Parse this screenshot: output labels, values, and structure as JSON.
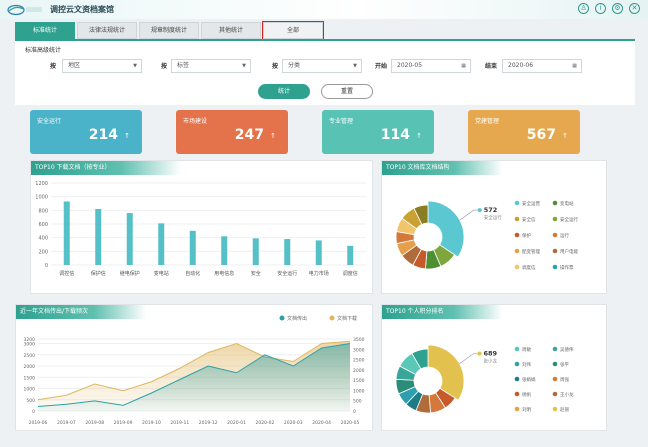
{
  "app": {
    "title": "调控云文资档案馆"
  },
  "top_icons": [
    "user-icon",
    "info-icon",
    "settings-icon",
    "close-icon"
  ],
  "tabs": [
    {
      "label": "标准统计",
      "active": true
    },
    {
      "label": "法律法规统计",
      "active": false
    },
    {
      "label": "规章制度统计",
      "active": false
    },
    {
      "label": "其他统计",
      "active": false
    },
    {
      "label": "全部",
      "active": false,
      "highlighted": true
    }
  ],
  "filters": {
    "title": "标准高级统计",
    "by_area_label": "按",
    "area_value": "地区",
    "by_tag_label": "按",
    "tag_value": "标签",
    "by_category_label": "按",
    "category_value": "分类",
    "start_label": "开始",
    "start_value": "2020-05",
    "end_label": "结束",
    "end_value": "2020-06",
    "stat_button": "统计",
    "reset_button": "重置"
  },
  "cards": [
    {
      "label": "安全运行",
      "value": "214",
      "color": "#4bb3c9"
    },
    {
      "label": "市场建设",
      "value": "247",
      "color": "#e4724b"
    },
    {
      "label": "专业管理",
      "value": "114",
      "color": "#58c2b5"
    },
    {
      "label": "党建管理",
      "value": "567",
      "color": "#e6a84e"
    }
  ],
  "panels": {
    "download_title": "TOP10 下载文档（按专业）",
    "structure_title": "TOP10 文档库文档结构",
    "trend_title": "近一年文档传出/下载频次",
    "ranking_title": "TOP10 个人积分排名"
  },
  "chart_data": [
    {
      "type": "bar",
      "title": "TOP10 下载文档（按专业）",
      "categories": [
        "调控信",
        "保护信",
        "继电保护",
        "变电站",
        "自动化",
        "用电信息",
        "安全",
        "安全运行",
        "电力市场",
        "调度信"
      ],
      "values": [
        930,
        820,
        760,
        610,
        500,
        420,
        390,
        380,
        360,
        280
      ],
      "yticks": [
        0,
        200,
        400,
        600,
        800,
        1000,
        1200
      ],
      "ylim": [
        0,
        1200
      ]
    },
    {
      "type": "pie",
      "title": "TOP10 文档库文档结构",
      "callout_value": "572",
      "callout_label": "安全运行",
      "slices": [
        {
          "value": 572,
          "color": "#5bc7d0"
        },
        {
          "value": 150,
          "color": "#7fa53d"
        },
        {
          "value": 130,
          "color": "#4f8f33"
        },
        {
          "value": 110,
          "color": "#c65a2a"
        },
        {
          "value": 120,
          "color": "#b06b3b"
        },
        {
          "value": 110,
          "color": "#e6a04a"
        },
        {
          "value": 100,
          "color": "#d4783c"
        },
        {
          "value": 120,
          "color": "#f2c46c"
        },
        {
          "value": 130,
          "color": "#c9a233"
        },
        {
          "value": 120,
          "color": "#8a7d24"
        }
      ],
      "legend": [
        {
          "label": "安全运营",
          "color": "#5bc7d0"
        },
        {
          "label": "变电站",
          "color": "#4f8f33"
        },
        {
          "label": "安全信",
          "color": "#c9a233"
        },
        {
          "label": "安全运行",
          "color": "#7fa53d"
        },
        {
          "label": "保护",
          "color": "#c65a2a"
        },
        {
          "label": "运行",
          "color": "#d4783c"
        },
        {
          "label": "配变管理",
          "color": "#e6a04a"
        },
        {
          "label": "用户电能",
          "color": "#b06b3b"
        },
        {
          "label": "调度信",
          "color": "#f2c46c"
        },
        {
          "label": "操作票",
          "color": "#2e9fb0"
        }
      ]
    },
    {
      "type": "area",
      "title": "近一年文档传出/下载频次",
      "x": [
        "2019-06",
        "2019-07",
        "2019-08",
        "2019-09",
        "2019-10",
        "2019-11",
        "2019-12",
        "2020-01",
        "2020-02",
        "2020-03",
        "2020-04",
        "2020-05"
      ],
      "series": [
        {
          "name": "文档传出",
          "color": "#2e9fa8",
          "values": [
            200,
            300,
            450,
            250,
            800,
            1400,
            2000,
            1700,
            2500,
            2000,
            2800,
            3000
          ]
        },
        {
          "name": "文档下载",
          "color": "#e0b660",
          "values": [
            500,
            700,
            1200,
            900,
            1300,
            1900,
            2600,
            3000,
            2400,
            2200,
            3000,
            3100
          ]
        }
      ],
      "yticks_left": [
        0,
        500,
        1000,
        1500,
        2000,
        2500,
        3000,
        3200
      ],
      "yticks_right": [
        0,
        500,
        1000,
        1500,
        2000,
        2500,
        3000,
        3500
      ],
      "ylim": [
        0,
        3200
      ]
    },
    {
      "type": "pie",
      "title": "TOP10 个人积分排名",
      "callout_value": "689",
      "callout_label": "张小龙",
      "slices": [
        {
          "value": 689,
          "color": "#e2c14f"
        },
        {
          "value": 140,
          "color": "#c65a2a"
        },
        {
          "value": 160,
          "color": "#d4783c"
        },
        {
          "value": 150,
          "color": "#b06b3b"
        },
        {
          "value": 120,
          "color": "#1f7b84"
        },
        {
          "value": 130,
          "color": "#2e9fb0"
        },
        {
          "value": 150,
          "color": "#2b8d77"
        },
        {
          "value": 140,
          "color": "#3aa598"
        },
        {
          "value": 180,
          "color": "#5bc7b8"
        },
        {
          "value": 170,
          "color": "#2fa18f"
        }
      ],
      "legend": [
        {
          "label": "周敏",
          "color": "#5bc7b8"
        },
        {
          "label": "吴德伟",
          "color": "#3aa598"
        },
        {
          "label": "刘伟",
          "color": "#2e9fb0"
        },
        {
          "label": "张平",
          "color": "#2b8d77"
        },
        {
          "label": "张娟娟",
          "color": "#1f7b84"
        },
        {
          "label": "周强",
          "color": "#d4783c"
        },
        {
          "label": "杨帆",
          "color": "#c65a2a"
        },
        {
          "label": "王小龙",
          "color": "#b06b3b"
        },
        {
          "label": "刘明",
          "color": "#e6a04a"
        },
        {
          "label": "赵丽",
          "color": "#e2c14f"
        }
      ]
    }
  ]
}
